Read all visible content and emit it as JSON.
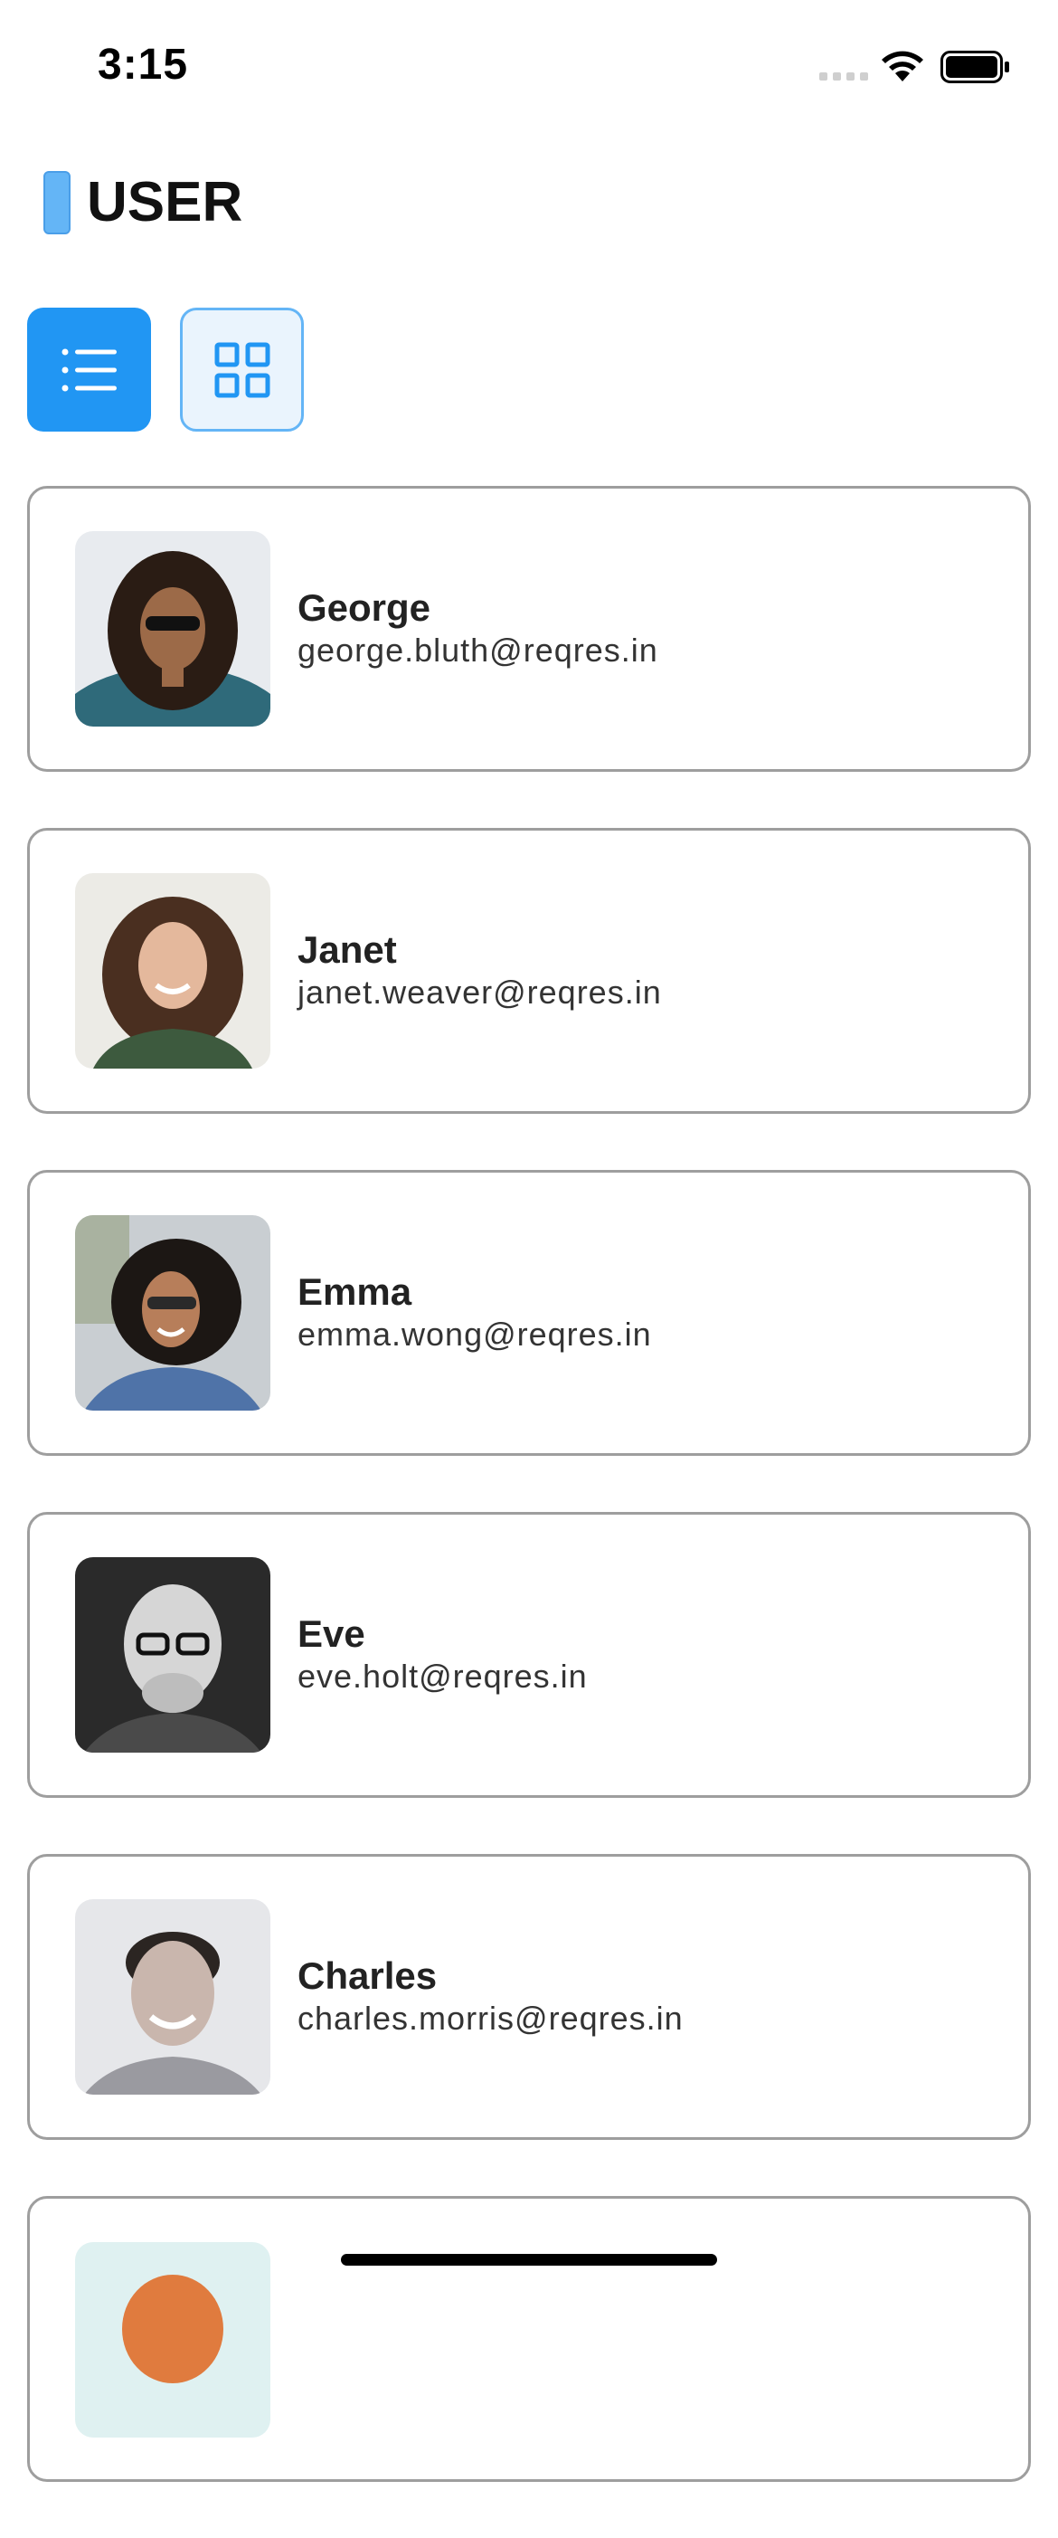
{
  "status_bar": {
    "time": "3:15"
  },
  "header": {
    "title": "USER"
  },
  "view_toggle": {
    "options": [
      {
        "icon": "list-icon",
        "active": true
      },
      {
        "icon": "grid-icon",
        "active": false
      }
    ]
  },
  "users": [
    {
      "name": "George",
      "email": "george.bluth@reqres.in"
    },
    {
      "name": "Janet",
      "email": "janet.weaver@reqres.in"
    },
    {
      "name": "Emma",
      "email": "emma.wong@reqres.in"
    },
    {
      "name": "Eve",
      "email": "eve.holt@reqres.in"
    },
    {
      "name": "Charles",
      "email": "charles.morris@reqres.in"
    }
  ],
  "colors": {
    "accent": "#2196f3",
    "accent_light": "#64b5f6",
    "card_border": "#9e9e9e"
  }
}
